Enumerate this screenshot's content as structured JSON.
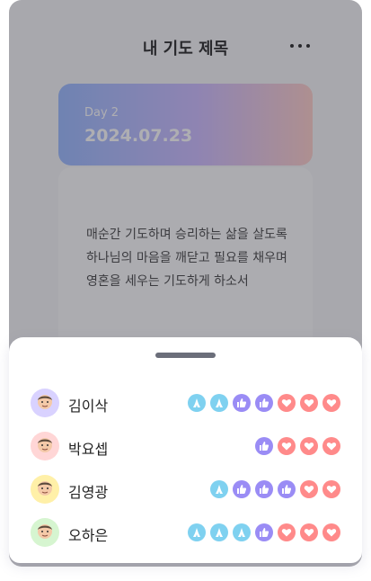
{
  "header": {
    "title": "내 기도 제목"
  },
  "day_card": {
    "label": "Day 2",
    "date": "2024.07.23"
  },
  "prayer": {
    "lines": [
      "매순간 기도하며 승리하는 삶을 살도록",
      "하나님의 마음을 깨닫고 필요를 채우며",
      "영혼을 세우는 기도하게 하소서"
    ]
  },
  "colors": {
    "pray": "#7fd1f0",
    "like": "#9a8cf5",
    "heart": "#ff8a8a"
  },
  "reactions": [
    {
      "name": "김이삭",
      "avatar_icon": "memoji-avatar-icon",
      "avatar_bg": "#d9d2ff",
      "icons": [
        "pray",
        "pray",
        "like",
        "like",
        "heart",
        "heart",
        "heart"
      ]
    },
    {
      "name": "박요셉",
      "avatar_icon": "memoji-avatar-icon",
      "avatar_bg": "#ffd6d6",
      "icons": [
        "like",
        "heart",
        "heart",
        "heart"
      ]
    },
    {
      "name": "김영광",
      "avatar_icon": "memoji-avatar-icon",
      "avatar_bg": "#fff0a8",
      "icons": [
        "pray",
        "like",
        "like",
        "like",
        "heart",
        "heart"
      ]
    },
    {
      "name": "오하은",
      "avatar_icon": "memoji-avatar-icon",
      "avatar_bg": "#d6f5d0",
      "icons": [
        "pray",
        "pray",
        "pray",
        "like",
        "heart",
        "heart",
        "heart"
      ]
    }
  ]
}
